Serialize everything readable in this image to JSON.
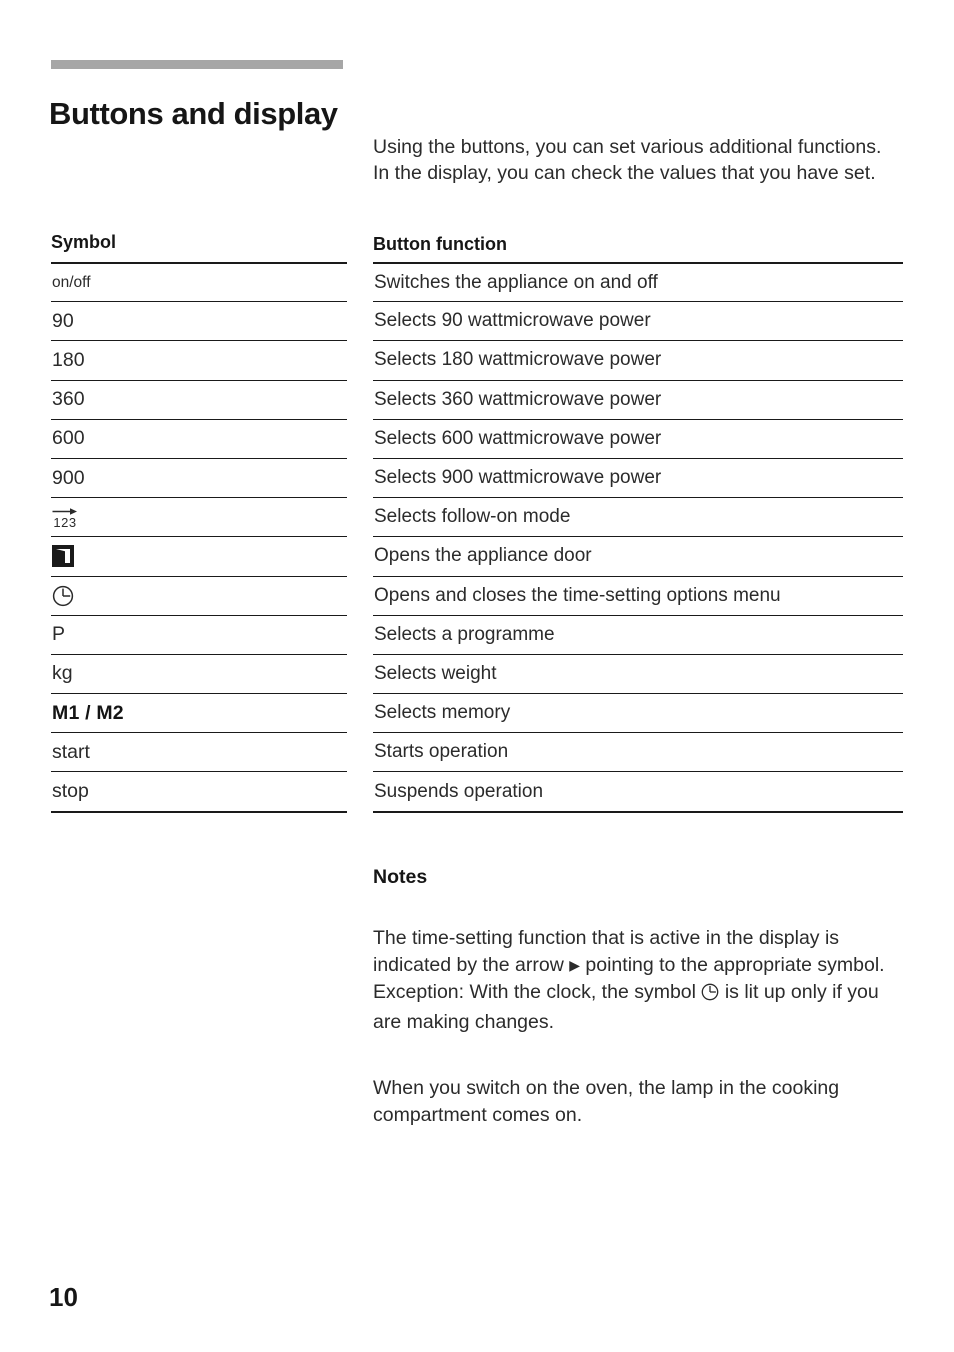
{
  "document": {
    "title": "Buttons and display",
    "page_number": "10",
    "intro": "Using the buttons, you can set various additional functions. In the display, you can check the values that you have set."
  },
  "table": {
    "headers": {
      "symbol": "Symbol",
      "function": "Button function"
    },
    "rows": [
      {
        "symbol": "on/off",
        "symbol_style": "small",
        "function": "Switches the appliance on and off"
      },
      {
        "symbol": "90",
        "symbol_style": "normal",
        "function": "Selects 90 wattmicrowave power"
      },
      {
        "symbol": "180",
        "symbol_style": "normal",
        "function": "Selects 180 wattmicrowave power"
      },
      {
        "symbol": "360",
        "symbol_style": "normal",
        "function": "Selects 360 wattmicrowave power"
      },
      {
        "symbol": "600",
        "symbol_style": "normal",
        "function": "Selects 600 wattmicrowave power"
      },
      {
        "symbol": "900",
        "symbol_style": "normal",
        "function": "Selects 900 wattmicrowave power"
      },
      {
        "symbol": "123",
        "symbol_style": "icon",
        "icon": "arrow-over-123-icon",
        "function": "Selects follow-on mode"
      },
      {
        "symbol": "",
        "symbol_style": "icon",
        "icon": "appliance-door-icon",
        "function": "Opens the appliance door"
      },
      {
        "symbol": "",
        "symbol_style": "icon",
        "icon": "clock-icon",
        "function": "Opens and closes the time-setting options menu"
      },
      {
        "symbol": "P",
        "symbol_style": "normal",
        "function": "Selects a programme"
      },
      {
        "symbol": "kg",
        "symbol_style": "normal",
        "function": "Selects weight"
      },
      {
        "symbol": "M1 / M2",
        "symbol_style": "bold",
        "function": "Selects memory"
      },
      {
        "symbol": "start",
        "symbol_style": "normal",
        "function": "Starts operation"
      },
      {
        "symbol": "stop",
        "symbol_style": "normal",
        "function": "Suspends operation"
      }
    ]
  },
  "notes": {
    "heading": "Notes",
    "paragraph1_part1": "The time-setting function that is active in the display is indicated by the arrow",
    "paragraph1_part2": "pointing to the appropriate symbol.",
    "paragraph1_part3": "Exception: With the clock, the symbol",
    "paragraph1_part4": "is lit up only if you are making changes.",
    "paragraph2": "When you switch on the oven, the lamp in the cooking compartment comes on."
  },
  "colors": {
    "accent_bar": "#a6a6a6",
    "text": "#2b2b2b",
    "rule": "#1a1a1a"
  }
}
